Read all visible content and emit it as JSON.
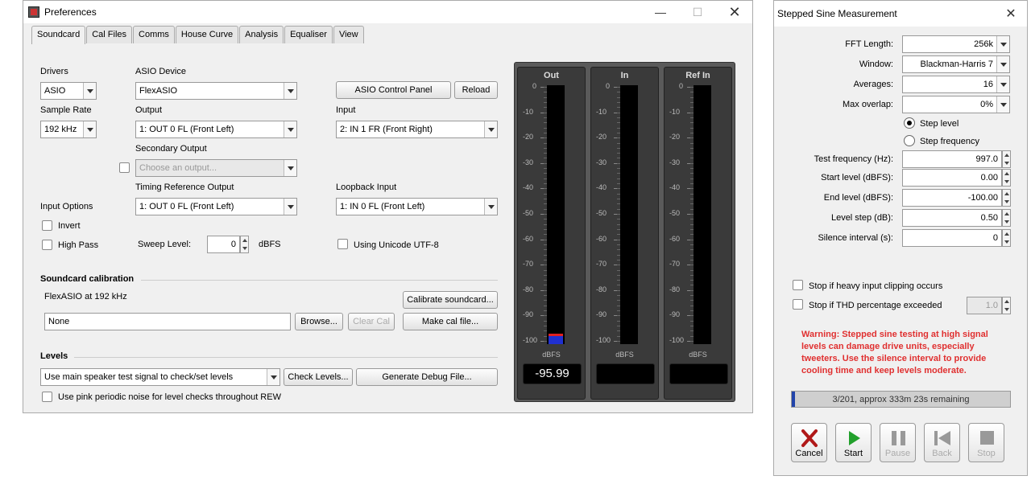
{
  "prefs": {
    "title": "Preferences",
    "tabs": [
      "Soundcard",
      "Cal Files",
      "Comms",
      "House Curve",
      "Analysis",
      "Equaliser",
      "View"
    ],
    "drivers_label": "Drivers",
    "drivers_value": "ASIO",
    "asio_device_label": "ASIO Device",
    "asio_device_value": "FlexASIO",
    "asio_control_panel": "ASIO Control Panel",
    "reload": "Reload",
    "sample_rate_label": "Sample Rate",
    "sample_rate_value": "192 kHz",
    "output_label": "Output",
    "output_value": "1: OUT 0 FL (Front Left)",
    "input_label": "Input",
    "input_value": "2: IN 1 FR (Front Right)",
    "secondary_output_label": "Secondary Output",
    "secondary_output_placeholder": "Choose an output...",
    "timing_ref_label": "Timing Reference Output",
    "timing_ref_value": "1: OUT 0 FL (Front Left)",
    "loopback_label": "Loopback Input",
    "loopback_value": "1: IN 0 FL (Front Left)",
    "input_options_label": "Input Options",
    "invert": "Invert",
    "high_pass": "High Pass",
    "sweep_level_label": "Sweep Level:",
    "sweep_level_value": "0",
    "sweep_level_unit": "dBFS",
    "unicode_label": "Using Unicode UTF-8",
    "calibration_heading": "Soundcard calibration",
    "calibration_info": "FlexASIO at 192 kHz",
    "calibrate_button": "Calibrate soundcard...",
    "cal_file_value": "None",
    "browse": "Browse...",
    "clear_cal": "Clear Cal",
    "make_cal": "Make cal file...",
    "levels_heading": "Levels",
    "levels_select": "Use main speaker test signal to check/set levels",
    "check_levels": "Check Levels...",
    "debug_file": "Generate Debug File...",
    "pink_noise": "Use pink periodic noise for level checks throughout REW"
  },
  "meters": {
    "ticks": [
      "0",
      "-10",
      "-20",
      "-30",
      "-40",
      "-50",
      "-60",
      "-70",
      "-80",
      "-90",
      "-100"
    ],
    "unit": "dBFS",
    "items": [
      {
        "title": "Out",
        "value": "-95.99",
        "level": -96
      },
      {
        "title": "In",
        "value": "",
        "level": -100
      },
      {
        "title": "Ref In",
        "value": "",
        "level": -100
      }
    ]
  },
  "stepped": {
    "title": "Stepped Sine Measurement",
    "fft_label": "FFT Length:",
    "fft_value": "256k",
    "window_label": "Window:",
    "window_value": "Blackman-Harris 7",
    "averages_label": "Averages:",
    "averages_value": "16",
    "overlap_label": "Max overlap:",
    "overlap_value": "0%",
    "step_level": "Step level",
    "step_frequency": "Step frequency",
    "test_freq_label": "Test frequency (Hz):",
    "test_freq_value": "997.0",
    "start_level_label": "Start level (dBFS):",
    "start_level_value": "0.00",
    "end_level_label": "End level (dBFS):",
    "end_level_value": "-100.00",
    "level_step_label": "Level step (dB):",
    "level_step_value": "0.50",
    "silence_label": "Silence interval (s):",
    "silence_value": "0",
    "stop_clipping": "Stop if heavy input clipping occurs",
    "stop_thd": "Stop if THD percentage exceeded",
    "thd_value": "1.0",
    "warning": "Warning: Stepped sine testing at high signal levels can damage drive units, especially tweeters. Use the silence interval to provide cooling time and keep levels moderate.",
    "progress_text": "3/201, approx 333m 23s remaining",
    "progress_fraction": 0.015,
    "buttons": [
      "Cancel",
      "Start",
      "Pause",
      "Back",
      "Stop"
    ],
    "warning_color": "#e03030"
  }
}
